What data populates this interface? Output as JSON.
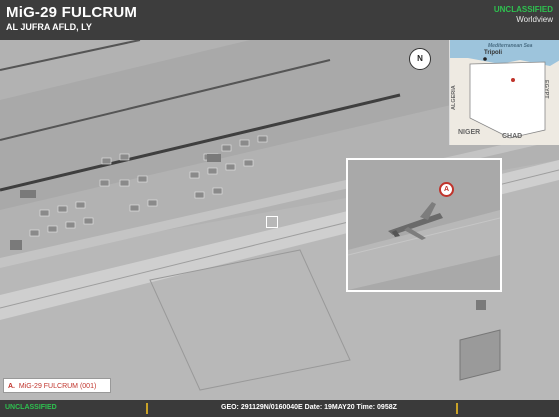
{
  "header": {
    "title": "MiG-29 FULCRUM",
    "subtitle": "AL JUFRA AFLD, LY",
    "classification": "UNCLASSIFIED",
    "scope": "Worldview"
  },
  "north_arrow": {
    "label": "N"
  },
  "locator_map": {
    "labels": [
      "Tripoli",
      "Mediterranean Sea",
      "ALGERIA",
      "NIGER",
      "CHAD",
      "EGYPT"
    ]
  },
  "callout": {
    "marker_letter": "A"
  },
  "legend": {
    "letter": "A.",
    "text": "MiG-29 FULCRUM (001)"
  },
  "footer": {
    "classification": "UNCLASSIFIED",
    "geo_line": "GEO: 291129N/0160040E   Date: 19MAY20   Time: 0958Z"
  },
  "colors": {
    "classification_green": "#2ec04f",
    "marker_red": "#c0332b",
    "footer_tick_gold": "#c9a227"
  }
}
